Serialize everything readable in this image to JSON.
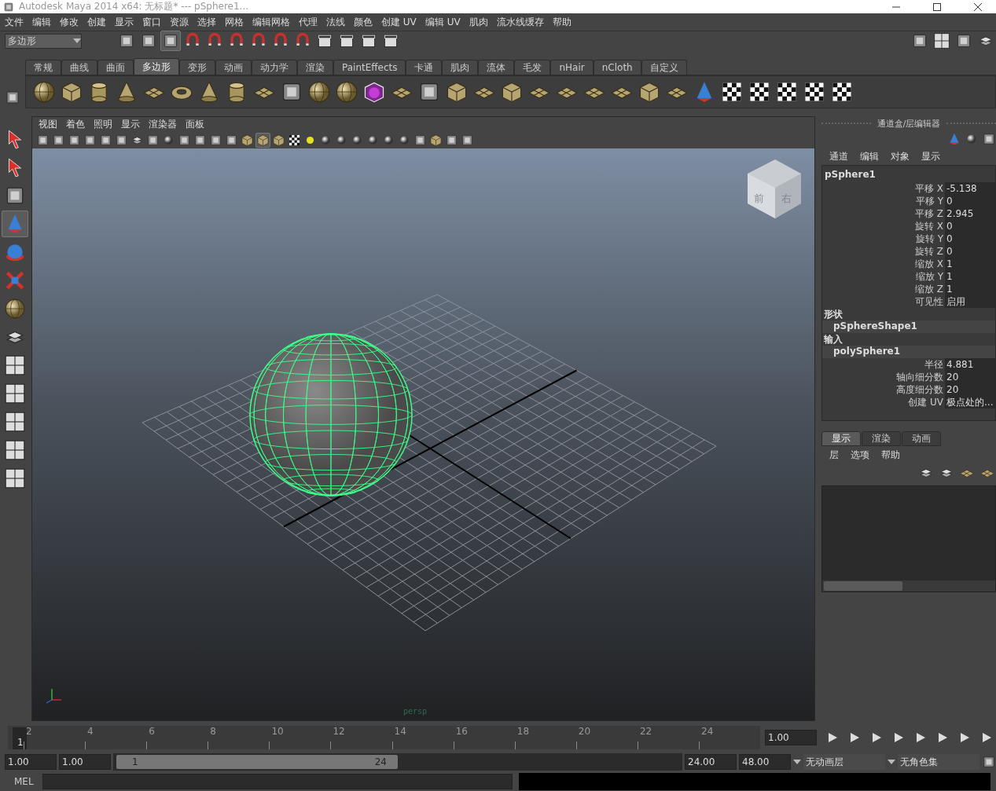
{
  "window": {
    "title": "Autodesk Maya 2014 x64: 无标题*   ---   pSphere1..."
  },
  "menu_bar": [
    "文件",
    "编辑",
    "修改",
    "创建",
    "显示",
    "窗口",
    "资源",
    "选择",
    "网格",
    "编辑网格",
    "代理",
    "法线",
    "颜色",
    "创建 UV",
    "编辑 UV",
    "肌肉",
    "流水线缓存",
    "帮助"
  ],
  "status_line": {
    "mode": "多边形"
  },
  "shelf": {
    "tabs": [
      {
        "label": "常规",
        "selected": false
      },
      {
        "label": "曲线",
        "selected": false
      },
      {
        "label": "曲面",
        "selected": false
      },
      {
        "label": "多边形",
        "selected": true
      },
      {
        "label": "变形",
        "selected": false
      },
      {
        "label": "动画",
        "selected": false
      },
      {
        "label": "动力学",
        "selected": false
      },
      {
        "label": "渲染",
        "selected": false
      },
      {
        "label": "PaintEffects",
        "selected": false
      },
      {
        "label": "卡通",
        "selected": false
      },
      {
        "label": "肌肉",
        "selected": false
      },
      {
        "label": "流体",
        "selected": false
      },
      {
        "label": "毛发",
        "selected": false
      },
      {
        "label": "nHair",
        "selected": false
      },
      {
        "label": "nCloth",
        "selected": false
      },
      {
        "label": "自定义",
        "selected": false
      }
    ]
  },
  "viewport": {
    "menu": [
      "视图",
      "着色",
      "照明",
      "显示",
      "渲染器",
      "面板"
    ],
    "view_cube": {
      "front": "前",
      "right": "右"
    },
    "camera": "persp"
  },
  "channel_box": {
    "title": "通道盒/层编辑器",
    "menu": [
      "通道",
      "编辑",
      "对象",
      "显示"
    ],
    "object": "pSphere1",
    "channels": [
      {
        "name": "平移 X",
        "value": "-5.138"
      },
      {
        "name": "平移 Y",
        "value": "0"
      },
      {
        "name": "平移 Z",
        "value": "2.945"
      },
      {
        "name": "旋转 X",
        "value": "0"
      },
      {
        "name": "旋转 Y",
        "value": "0"
      },
      {
        "name": "旋转 Z",
        "value": "0"
      },
      {
        "name": "缩放 X",
        "value": "1"
      },
      {
        "name": "缩放 Y",
        "value": "1"
      },
      {
        "name": "缩放 Z",
        "value": "1"
      },
      {
        "name": "可见性",
        "value": "启用"
      }
    ],
    "shapes_label": "形状",
    "shape": "pSphereShape1",
    "inputs_label": "输入",
    "input": "polySphere1",
    "input_channels": [
      {
        "name": "半径",
        "value": "4.881"
      },
      {
        "name": "轴向细分数",
        "value": "20"
      },
      {
        "name": "高度细分数",
        "value": "20"
      },
      {
        "name": "创建 UV",
        "value": "极点处的..."
      }
    ]
  },
  "layer_editor": {
    "tabs": [
      {
        "label": "显示",
        "selected": true
      },
      {
        "label": "渲染",
        "selected": false
      },
      {
        "label": "动画",
        "selected": false
      }
    ],
    "menu": [
      "层",
      "选项",
      "帮助"
    ]
  },
  "timeline": {
    "ticks": [
      "2",
      "4",
      "6",
      "8",
      "10",
      "12",
      "14",
      "16",
      "18",
      "20",
      "22",
      "24"
    ],
    "current_frame": "1",
    "current_time": "1.00",
    "level": 0
  },
  "range_slider": {
    "level": 0.5,
    "start": "1.00",
    "playback_start": "1.00",
    "range_start": "1",
    "range_end": "24",
    "playback_end": "24.00",
    "end": "48.00",
    "anim_layer": "无动画层",
    "character_set": "无角色集"
  },
  "command_line": {
    "language": "MEL"
  }
}
